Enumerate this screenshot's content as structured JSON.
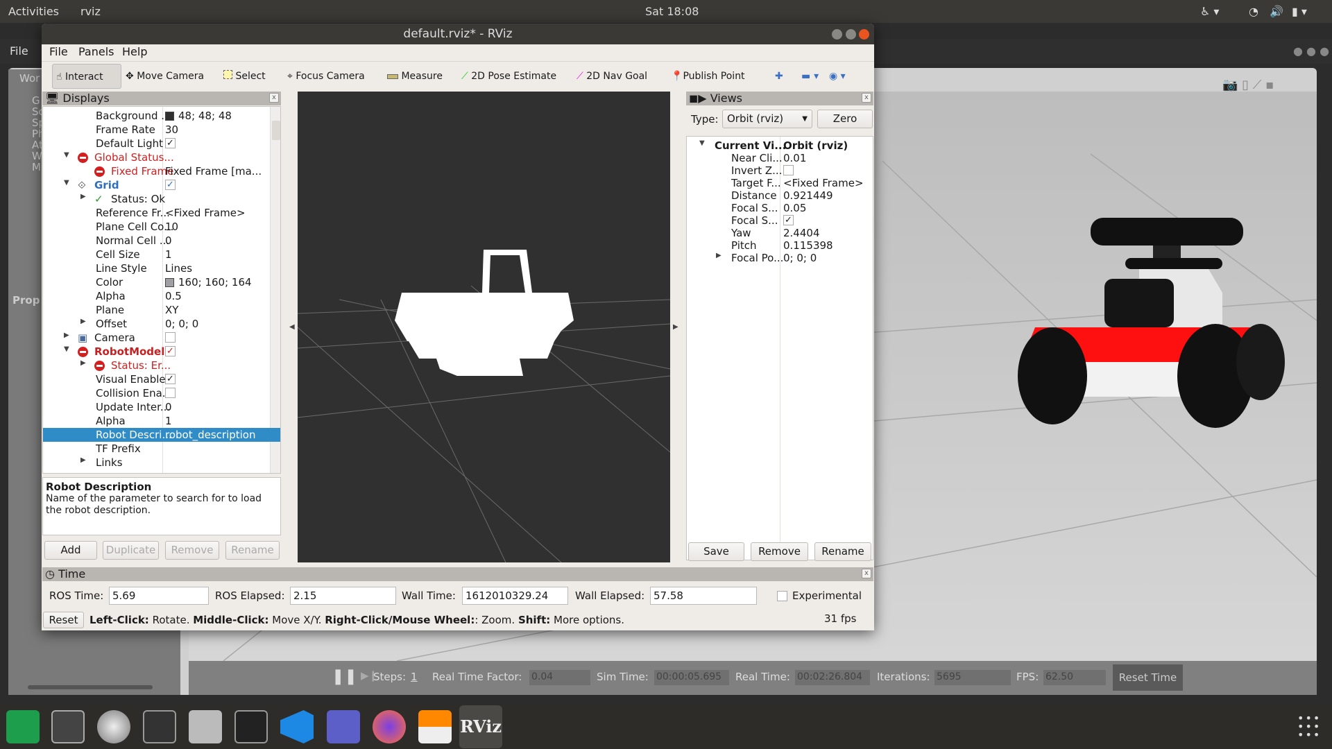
{
  "topbar": {
    "activities": "Activities",
    "app": "rviz",
    "clock": "Sat 18:08"
  },
  "gazebo": {
    "menu_file": "File",
    "left_fragments": [
      "Wor",
      "G",
      "Sc",
      "Sp",
      "Ph",
      "At",
      "W",
      "M",
      "Prop"
    ],
    "bar": {
      "steps_label": "Steps:",
      "steps_value": "1",
      "rtf_label": "Real Time Factor:",
      "rtf": "0.04",
      "sim_label": "Sim Time:",
      "sim": "00:00:05.695",
      "real_label": "Real Time:",
      "real": "00:02:26.804",
      "iter_label": "Iterations:",
      "iter": "5695",
      "fps_label": "FPS:",
      "fps": "62.50",
      "reset": "Reset Time"
    }
  },
  "window": {
    "title": "default.rviz* - RViz"
  },
  "menu": [
    "File",
    "Panels",
    "Help"
  ],
  "toolbar": [
    "Interact",
    "Move Camera",
    "Select",
    "Focus Camera",
    "Measure",
    "2D Pose Estimate",
    "2D Nav Goal",
    "Publish Point"
  ],
  "displays": {
    "title": "Displays",
    "rows": [
      {
        "name": "Background ...",
        "value": "48; 48; 48",
        "level": 1,
        "swatch": "#303030"
      },
      {
        "name": "Frame Rate",
        "value": "30",
        "level": 1
      },
      {
        "name": "Default Light",
        "level": 1,
        "check": true
      },
      {
        "name": "Global Status...",
        "level": 0,
        "exp": "open",
        "icon": "error",
        "style": "err"
      },
      {
        "name": "Fixed Frame",
        "value": "Fixed Frame [ma...",
        "level": 1,
        "icon": "error",
        "style": "err"
      },
      {
        "name": "Grid",
        "level": 0,
        "exp": "open",
        "icon": "grid",
        "style": "blue",
        "check": true,
        "checkcolor": "#2f6fc0"
      },
      {
        "name": "Status: Ok",
        "level": 1,
        "exp": "closed",
        "icon": "ok"
      },
      {
        "name": "Reference Fr...",
        "value": "<Fixed Frame>",
        "level": 1
      },
      {
        "name": "Plane Cell Co...",
        "value": "10",
        "level": 1
      },
      {
        "name": "Normal Cell ...",
        "value": "0",
        "level": 1
      },
      {
        "name": "Cell Size",
        "value": "1",
        "level": 1
      },
      {
        "name": "Line Style",
        "value": "Lines",
        "level": 1
      },
      {
        "name": "Color",
        "value": "160; 160; 164",
        "level": 1,
        "swatch": "#a0a0a4"
      },
      {
        "name": "Alpha",
        "value": "0.5",
        "level": 1
      },
      {
        "name": "Plane",
        "value": "XY",
        "level": 1
      },
      {
        "name": "Offset",
        "value": "0; 0; 0",
        "level": 1,
        "exp": "closed"
      },
      {
        "name": "Camera",
        "level": 0,
        "exp": "closed",
        "icon": "camera",
        "check": false
      },
      {
        "name": "RobotModel",
        "level": 0,
        "exp": "open",
        "icon": "error",
        "style": "errbold",
        "check": true,
        "checkcolor": "#c82020"
      },
      {
        "name": "Status: Er...",
        "level": 1,
        "exp": "closed",
        "icon": "error",
        "style": "err"
      },
      {
        "name": "Visual Enabled",
        "level": 1,
        "check": true
      },
      {
        "name": "Collision Ena...",
        "level": 1,
        "check": false
      },
      {
        "name": "Update Inter...",
        "value": "0",
        "level": 1
      },
      {
        "name": "Alpha",
        "value": "1",
        "level": 1
      },
      {
        "name": "Robot Descri...",
        "value": "robot_description",
        "level": 1,
        "selected": true
      },
      {
        "name": "TF Prefix",
        "value": "",
        "level": 1
      },
      {
        "name": "Links",
        "level": 1,
        "exp": "closed"
      }
    ],
    "desc_title": "Robot Description",
    "desc_text": "Name of the parameter to search for to load the robot description.",
    "buttons": [
      "Add",
      "Duplicate",
      "Remove",
      "Rename"
    ]
  },
  "views": {
    "title": "Views",
    "type_label": "Type:",
    "type_value": "Orbit (rviz)",
    "zero": "Zero",
    "rows": [
      {
        "name": "Current Vi...",
        "value": "Orbit (rviz)",
        "level": 0,
        "exp": "open",
        "style": "bold"
      },
      {
        "name": "Near Cli...",
        "value": "0.01",
        "level": 1
      },
      {
        "name": "Invert Z...",
        "level": 1,
        "check": false
      },
      {
        "name": "Target F...",
        "value": "<Fixed Frame>",
        "level": 1
      },
      {
        "name": "Distance",
        "value": "0.921449",
        "level": 1
      },
      {
        "name": "Focal S...",
        "value": "0.05",
        "level": 1
      },
      {
        "name": "Focal S...",
        "level": 1,
        "check": true
      },
      {
        "name": "Yaw",
        "value": "2.4404",
        "level": 1
      },
      {
        "name": "Pitch",
        "value": "0.115398",
        "level": 1
      },
      {
        "name": "Focal Po...",
        "value": "0; 0; 0",
        "level": 1,
        "exp": "closed"
      }
    ],
    "buttons": [
      "Save",
      "Remove",
      "Rename"
    ]
  },
  "time": {
    "title": "Time",
    "ros_time_label": "ROS Time:",
    "ros_time": "5.69",
    "ros_elapsed_label": "ROS Elapsed:",
    "ros_elapsed": "2.15",
    "wall_time_label": "Wall Time:",
    "wall_time": "1612010329.24",
    "wall_elapsed_label": "Wall Elapsed:",
    "wall_elapsed": "57.58",
    "experimental": "Experimental",
    "reset": "Reset",
    "hint": [
      [
        "Left-Click:",
        " Rotate. "
      ],
      [
        "Middle-Click:",
        " Move X/Y. "
      ],
      [
        "Right-Click/Mouse Wheel:",
        ": Zoom. "
      ],
      [
        "Shift:",
        " More options."
      ]
    ],
    "fps": "31 fps"
  },
  "dock": [
    "pycharm",
    "screenshot",
    "mongodb",
    "system-monitor",
    "files",
    "terminal",
    "vscode",
    "teams",
    "firefox",
    "sublime",
    "rviz"
  ],
  "colors": {
    "selection": "#308cc6",
    "error": "#d21f1f",
    "grid_blue": "#2f6fc0",
    "robot_red": "#ff1010"
  }
}
